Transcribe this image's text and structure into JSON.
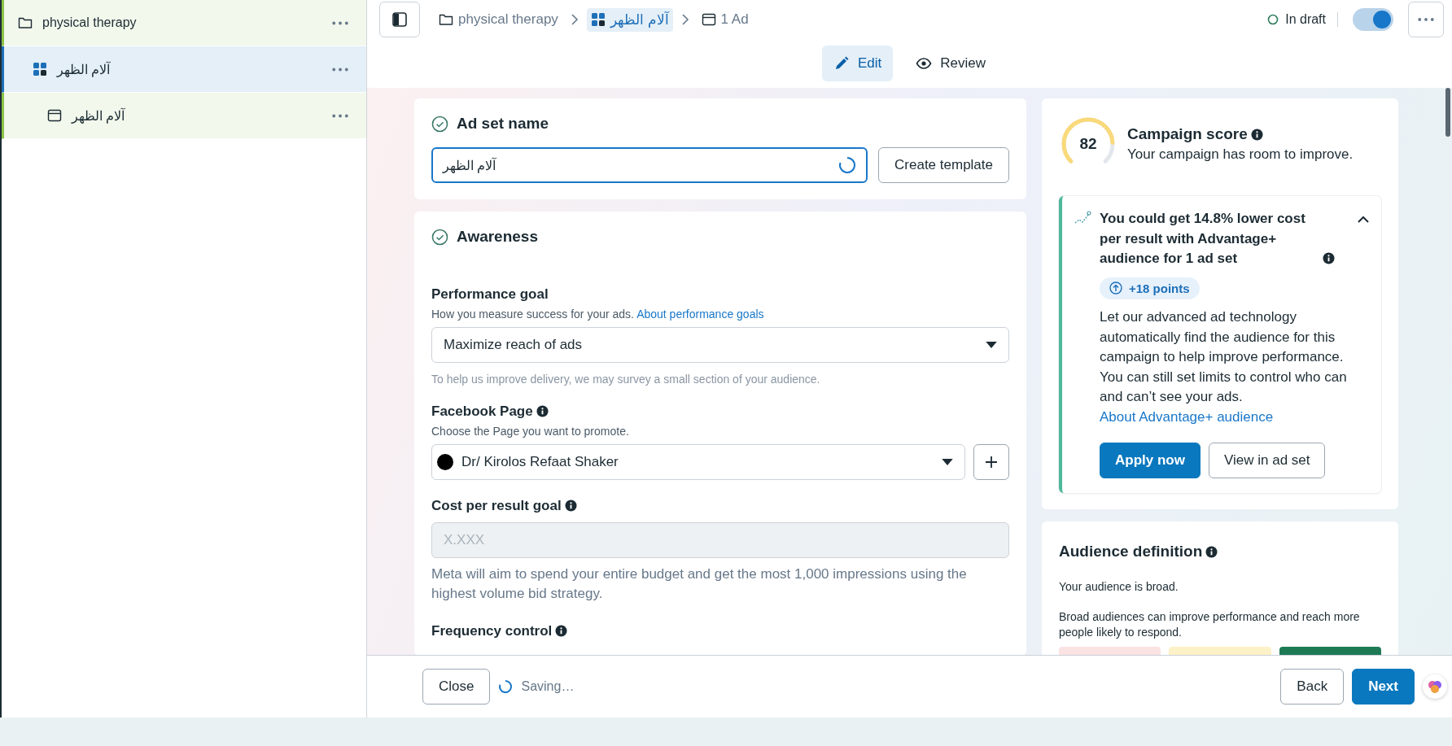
{
  "sidebar": {
    "items": [
      {
        "label": "physical therapy",
        "kind": "campaign",
        "selected": false,
        "children": [
          {
            "label": "آلام الظهر",
            "kind": "ad_set",
            "selected": true,
            "children": [
              {
                "label": "آلام الظهر",
                "kind": "ad",
                "selected": false
              }
            ]
          }
        ]
      }
    ]
  },
  "toolbar": {
    "breadcrumbs": [
      {
        "label": "physical therapy",
        "kind": "campaign",
        "selected": false
      },
      {
        "label": "آلام الظهر",
        "kind": "ad_set",
        "selected": true
      },
      {
        "label": "1 Ad",
        "kind": "ad",
        "selected": false
      }
    ],
    "status": "In draft",
    "toggle_on": true
  },
  "tabs": [
    {
      "label": "Edit",
      "kind": "edit",
      "selected": true
    },
    {
      "label": "Review",
      "kind": "review",
      "selected": false
    }
  ],
  "ad_set_name": {
    "title": "Ad set name",
    "value": "آلام الظهر",
    "button": "Create template"
  },
  "objective": {
    "title": "Awareness",
    "performance_goal": {
      "label": "Performance goal",
      "help": "How you measure success for your ads.",
      "link": "About performance goals",
      "value": "Maximize reach of ads",
      "note": "To help us improve delivery, we may survey a small section of your audience."
    },
    "facebook_page": {
      "label": "Facebook Page",
      "help": "Choose the Page you want to promote.",
      "value": "Dr/ Kirolos Refaat Shaker"
    },
    "cost_goal": {
      "label": "Cost per result goal",
      "placeholder": "X.XXX",
      "note": "Meta will aim to spend your entire budget and get the most 1,000 impressions using the highest volume bid strategy."
    },
    "frequency": {
      "label": "Frequency control"
    }
  },
  "campaign_score": {
    "score": "82",
    "level": 0.82,
    "title": "Campaign score",
    "subtitle": "Your campaign has room to improve.",
    "recommendation": {
      "expanded": true,
      "title": "You could get 14.8% lower cost per result with Advantage+ audience for 1 ad set",
      "badge": "+18 points",
      "body": "Let our advanced ad technology automatically find the audience for this campaign to help improve performance. You can still set limits to control who can and can’t see your ads.",
      "link": "About Advantage+ audience",
      "buttons": [
        "Apply now",
        "View in ad set"
      ]
    }
  },
  "audience_definition": {
    "title": "Audience definition",
    "status": "Your audience is broad.",
    "description": "Broad audiences can improve performance and reach more people likely to respond."
  },
  "footer": {
    "close": "Close",
    "status": "Saving…",
    "back": "Back",
    "next": "Next"
  }
}
